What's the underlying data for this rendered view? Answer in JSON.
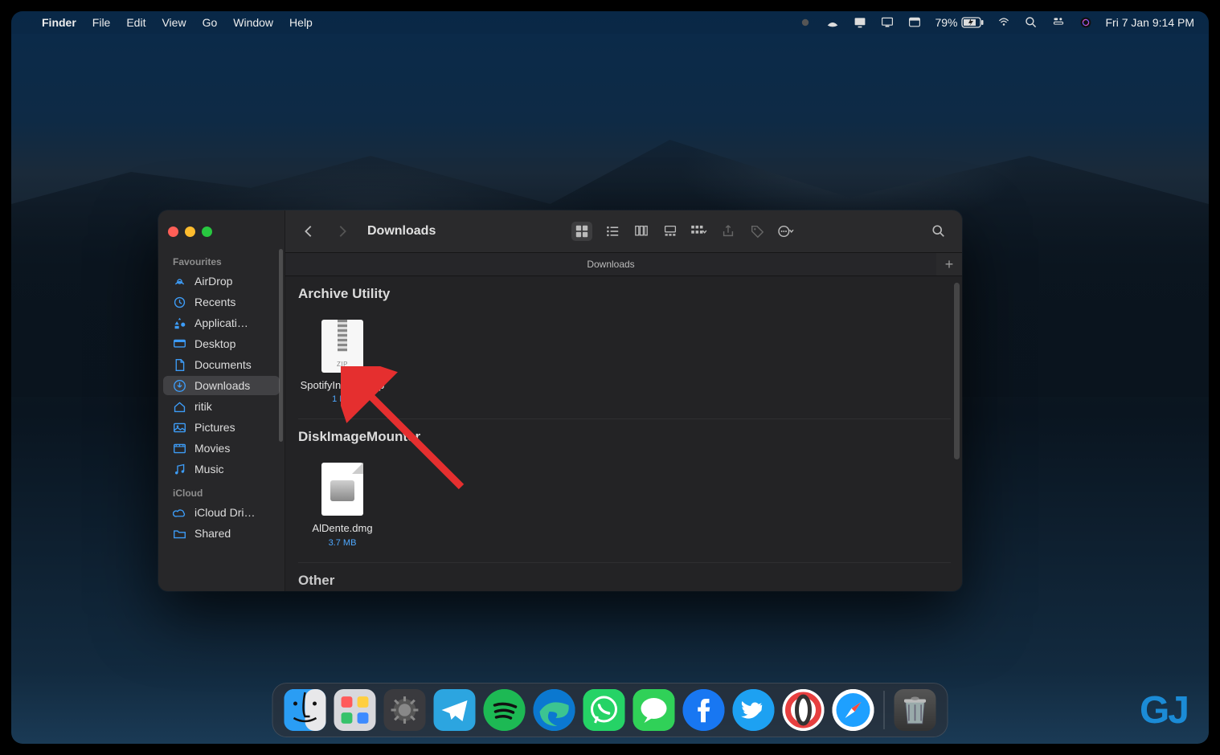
{
  "menubar": {
    "apple": "",
    "app": "Finder",
    "items": [
      "File",
      "Edit",
      "View",
      "Go",
      "Window",
      "Help"
    ],
    "battery_pct": "79%",
    "datetime": "Fri 7 Jan  9:14 PM"
  },
  "finder": {
    "title": "Downloads",
    "tab_label": "Downloads",
    "sidebar": {
      "sections": [
        {
          "title": "Favourites",
          "items": [
            {
              "icon": "airdrop",
              "label": "AirDrop"
            },
            {
              "icon": "clock",
              "label": "Recents"
            },
            {
              "icon": "apps",
              "label": "Applicati…"
            },
            {
              "icon": "desktop",
              "label": "Desktop"
            },
            {
              "icon": "doc",
              "label": "Documents"
            },
            {
              "icon": "download",
              "label": "Downloads",
              "selected": true
            },
            {
              "icon": "home",
              "label": "ritik"
            },
            {
              "icon": "picture",
              "label": "Pictures"
            },
            {
              "icon": "movie",
              "label": "Movies"
            },
            {
              "icon": "music",
              "label": "Music"
            }
          ]
        },
        {
          "title": "iCloud",
          "items": [
            {
              "icon": "cloud",
              "label": "iCloud Dri…"
            },
            {
              "icon": "folder",
              "label": "Shared"
            }
          ]
        }
      ]
    },
    "groups": [
      {
        "title": "Archive Utility",
        "files": [
          {
            "name": "SpotifyInstaller.zip",
            "size": "1 MB",
            "kind": "zip"
          }
        ]
      },
      {
        "title": "DiskImageMounter",
        "files": [
          {
            "name": "AlDente.dmg",
            "size": "3.7 MB",
            "kind": "dmg"
          }
        ]
      },
      {
        "title": "Other",
        "files": []
      }
    ]
  },
  "dock": {
    "apps": [
      "Finder",
      "Launchpad",
      "System Settings",
      "Telegram",
      "Spotify",
      "Edge",
      "WhatsApp",
      "Messages",
      "Facebook",
      "Twitter",
      "Opera",
      "Safari"
    ],
    "trash": "Trash"
  },
  "watermark": "GJ"
}
